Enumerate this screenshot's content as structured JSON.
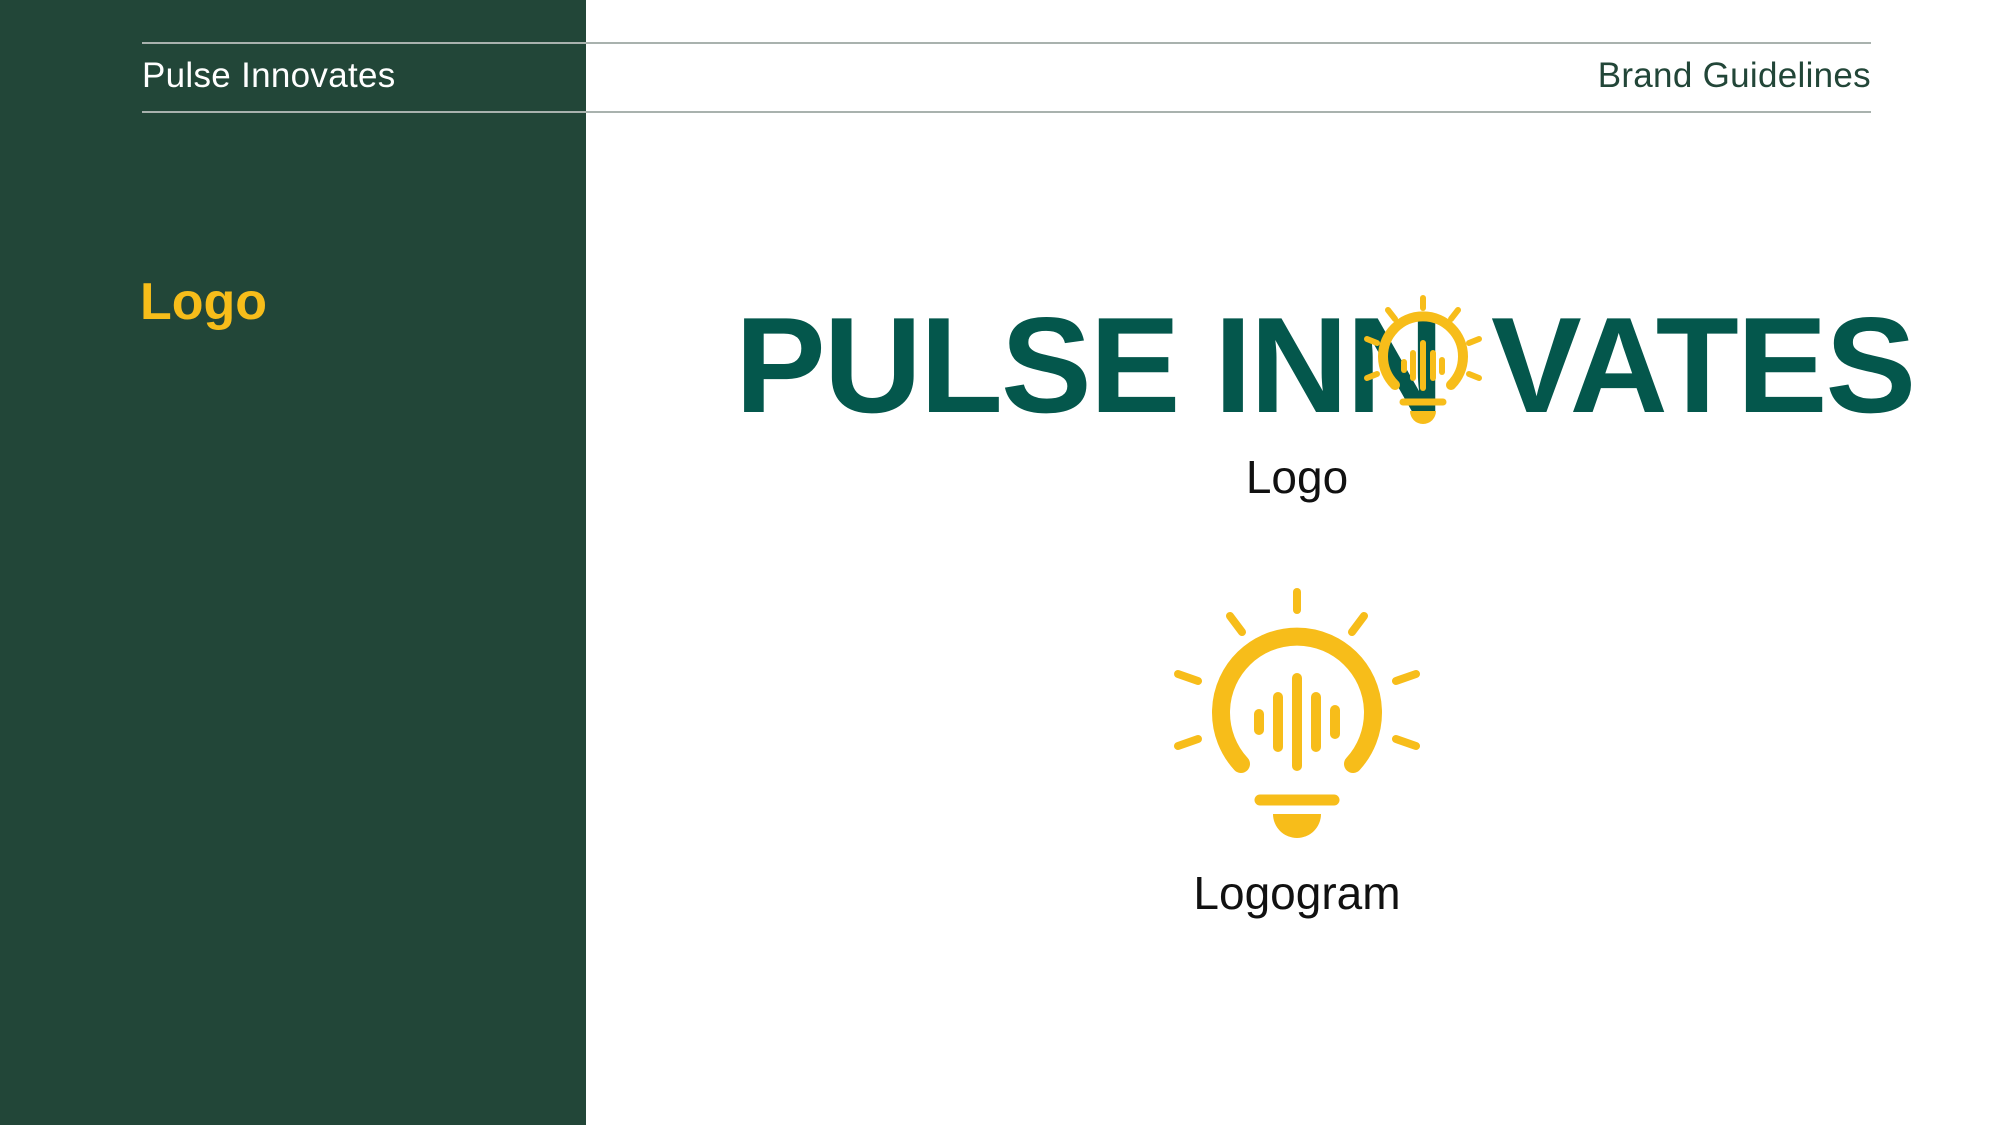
{
  "header": {
    "brand": "Pulse Innovates",
    "doc_title": "Brand Guidelines"
  },
  "sidebar": {
    "section_title": "Logo"
  },
  "main": {
    "wordmark_part1": "PULSE INN",
    "wordmark_part2": "VATES",
    "logo_caption": "Logo",
    "logogram_caption": "Logogram"
  },
  "colors": {
    "sidebar_bg": "#224638",
    "accent_yellow": "#f7bd1a",
    "wordmark_green": "#04574c"
  },
  "icons": {
    "wordmark_o": "lightbulb-pulse-icon",
    "logogram": "lightbulb-pulse-icon"
  }
}
